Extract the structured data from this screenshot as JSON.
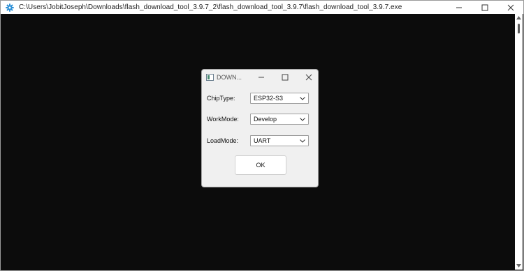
{
  "console": {
    "title": "C:\\Users\\JobitJoseph\\Downloads\\flash_download_tool_3.9.7_2\\flash_download_tool_3.9.7\\flash_download_tool_3.9.7.exe",
    "icon": "gear-icon",
    "controls": [
      "minimize-icon",
      "maximize-icon",
      "close-icon"
    ]
  },
  "dialog": {
    "title": "DOWN...",
    "fields": [
      {
        "label": "ChipType:",
        "value": "ESP32-S3"
      },
      {
        "label": "WorkMode:",
        "value": "Develop"
      },
      {
        "label": "LoadMode:",
        "value": "UART"
      }
    ],
    "ok_label": "OK"
  },
  "colors": {
    "console_bg": "#0c0c0c",
    "dialog_bg": "#f0f0f0",
    "accent": "#1a73b9"
  }
}
